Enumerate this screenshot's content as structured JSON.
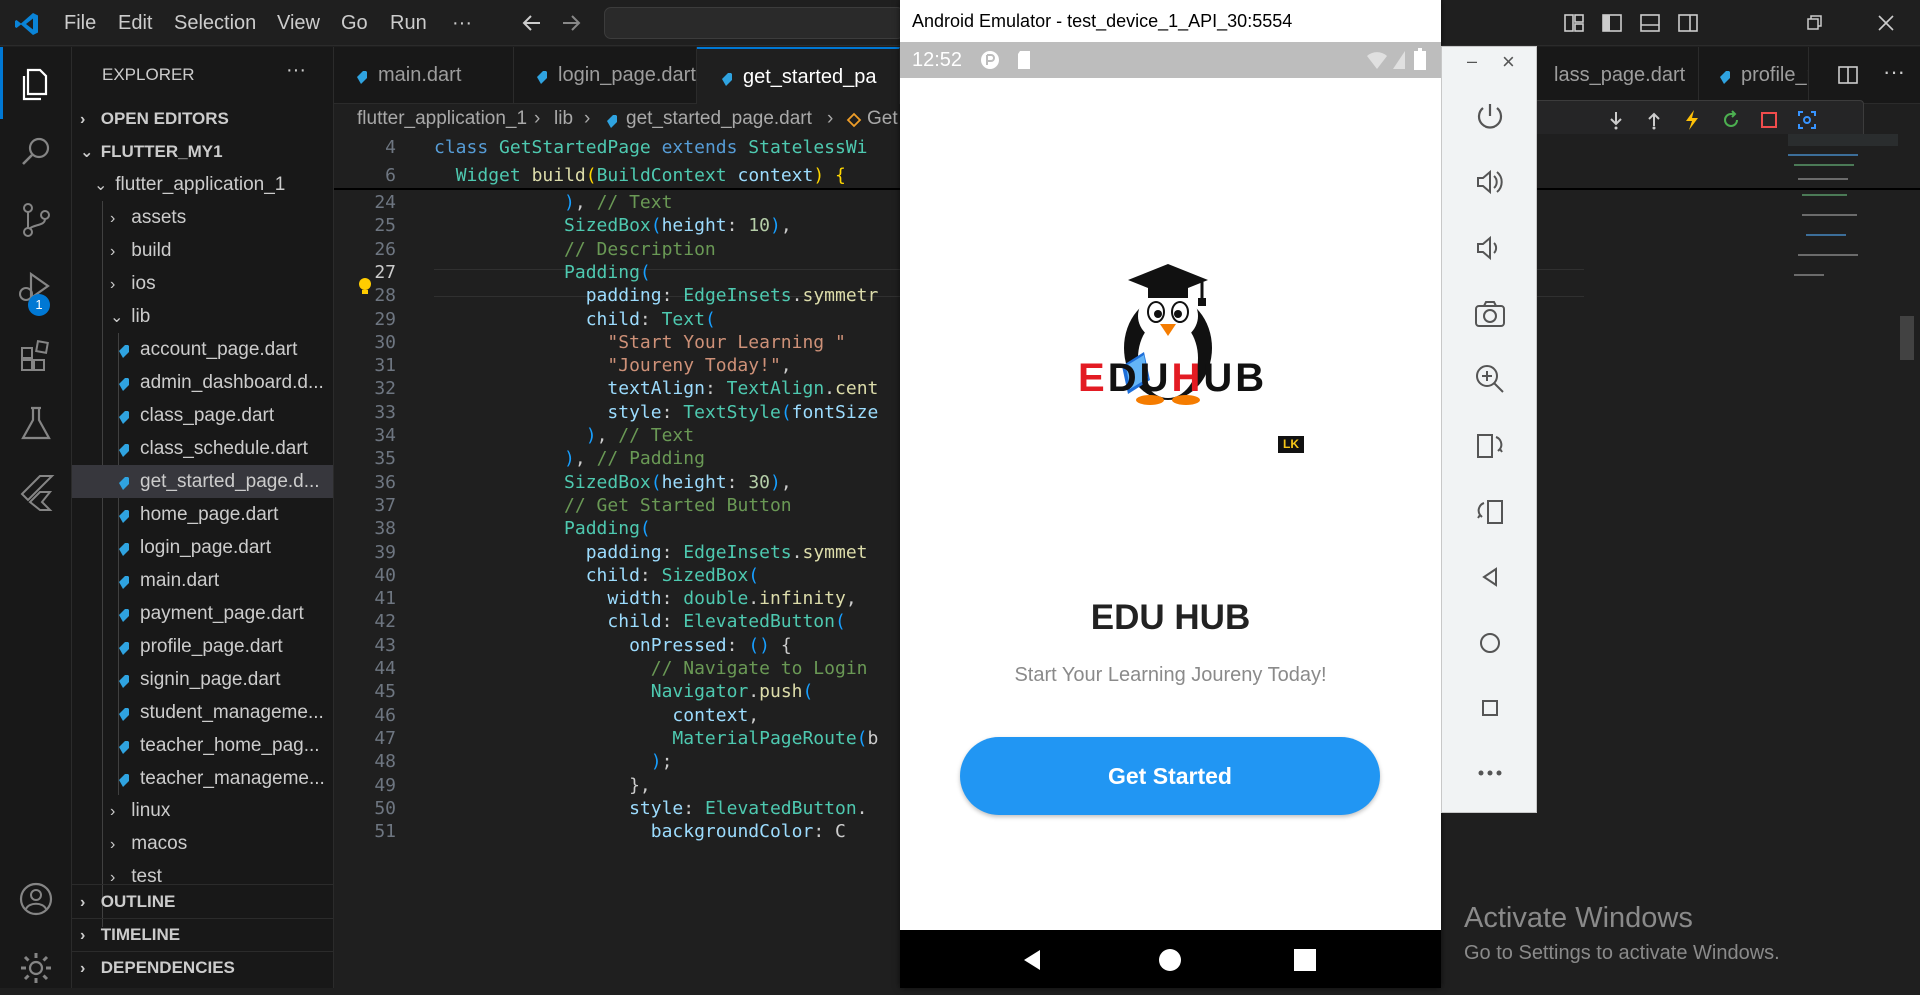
{
  "menu": {
    "items": [
      "File",
      "Edit",
      "Selection",
      "View",
      "Go",
      "Run",
      "···"
    ]
  },
  "activity": {
    "debug_badge": "1"
  },
  "explorer": {
    "title": "EXPLORER",
    "more": "···",
    "open_editors": "OPEN EDITORS",
    "project": "FLUTTER_MY1",
    "app_folder": "flutter_application_1",
    "folders_top": [
      "assets",
      "build",
      "ios",
      "lib"
    ],
    "lib_files": [
      "account_page.dart",
      "admin_dashboard.d...",
      "class_page.dart",
      "class_schedule.dart",
      "get_started_page.d...",
      "home_page.dart",
      "login_page.dart",
      "main.dart",
      "payment_page.dart",
      "profile_page.dart",
      "signin_page.dart",
      "student_manageme...",
      "teacher_home_pag...",
      "teacher_manageme..."
    ],
    "folders_bottom": [
      "linux",
      "macos",
      "test"
    ],
    "outline": "OUTLINE",
    "timeline": "TIMELINE",
    "dependencies": "DEPENDENCIES"
  },
  "tabs": [
    "main.dart",
    "login_page.dart",
    "get_started_pa",
    "lass_page.dart",
    "profile_p"
  ],
  "breadcrumb": {
    "folder": "flutter_application_1",
    "sub": "lib",
    "file": "get_started_page.dart",
    "symbol": "Get"
  },
  "editor": {
    "sticky": [
      {
        "n": "4",
        "text": "class GetStartedPage extends StatelessWi"
      },
      {
        "n": "6",
        "text": "  Widget build(BuildContext context) {"
      }
    ],
    "lines": [
      {
        "n": "24",
        "text": "            ), // Text"
      },
      {
        "n": "25",
        "text": "            SizedBox(height: 10),"
      },
      {
        "n": "26",
        "text": "            // Description"
      },
      {
        "n": "27",
        "text": "            Padding("
      },
      {
        "n": "28",
        "text": "              padding: EdgeInsets.symmetr"
      },
      {
        "n": "29",
        "text": "              child: Text("
      },
      {
        "n": "30",
        "text": "                \"Start Your Learning \""
      },
      {
        "n": "31",
        "text": "                \"Joureny Today!\","
      },
      {
        "n": "32",
        "text": "                textAlign: TextAlign.cent"
      },
      {
        "n": "33",
        "text": "                style: TextStyle(fontSize"
      },
      {
        "n": "34",
        "text": "              ), // Text"
      },
      {
        "n": "35",
        "text": "            ), // Padding"
      },
      {
        "n": "36",
        "text": "            SizedBox(height: 30),"
      },
      {
        "n": "37",
        "text": "            // Get Started Button"
      },
      {
        "n": "38",
        "text": "            Padding("
      },
      {
        "n": "39",
        "text": "              padding: EdgeInsets.symmet"
      },
      {
        "n": "40",
        "text": "              child: SizedBox("
      },
      {
        "n": "41",
        "text": "                width: double.infinity,"
      },
      {
        "n": "42",
        "text": "                child: ElevatedButton("
      },
      {
        "n": "43",
        "text": "                  onPressed: () {"
      },
      {
        "n": "44",
        "text": "                    // Navigate to Login"
      },
      {
        "n": "45",
        "text": "                    Navigator.push("
      },
      {
        "n": "46",
        "text": "                      context,"
      },
      {
        "n": "47",
        "text": "                      MaterialPageRoute(b"
      },
      {
        "n": "48",
        "text": "                    );"
      },
      {
        "n": "49",
        "text": "                  },"
      },
      {
        "n": "50",
        "text": "                  style: ElevatedButton."
      },
      {
        "n": "51",
        "text": "                    backgroundColor: C"
      }
    ]
  },
  "emulator": {
    "window_title": "Android Emulator - test_device_1_API_30:5554",
    "time": "12:52",
    "logo_text": "EDUHUB",
    "logo_badge": "LK",
    "app_title": "EDU HUB",
    "subtitle": "Start Your Learning Joureny Today!",
    "button": "Get Started",
    "minimize": "–",
    "close": "×"
  },
  "watermark": {
    "title": "Activate Windows",
    "sub": "Go to Settings to activate Windows."
  },
  "colors": {
    "accent": "#0078d4",
    "button": "#2196f3",
    "logo_red": "#e31b23"
  }
}
